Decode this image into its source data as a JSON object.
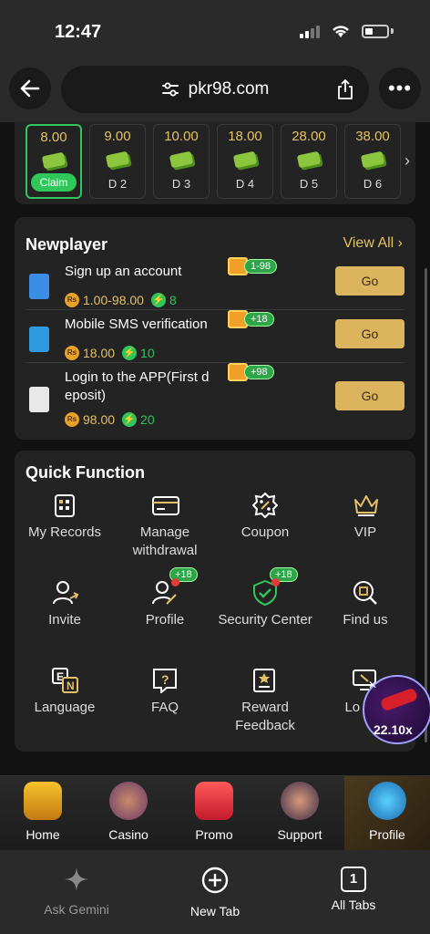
{
  "status": {
    "time": "12:47"
  },
  "browser": {
    "url": "pkr98.com"
  },
  "daily": [
    {
      "amount": "8.00",
      "label": "Claim",
      "active": true
    },
    {
      "amount": "9.00",
      "label": "D 2"
    },
    {
      "amount": "10.00",
      "label": "D 3"
    },
    {
      "amount": "18.00",
      "label": "D 4"
    },
    {
      "amount": "28.00",
      "label": "D 5"
    },
    {
      "amount": "38.00",
      "label": "D 6"
    }
  ],
  "newplayer": {
    "title": "Newplayer",
    "view_all": "View All",
    "tasks": [
      {
        "title": "Sign up an account",
        "badge": "1-98",
        "amount": "1.00-98.00",
        "points": "8",
        "go": "Go"
      },
      {
        "title": "Mobile SMS verification",
        "badge": "+18",
        "amount": "18.00",
        "points": "10",
        "go": "Go"
      },
      {
        "title": "Login to the APP(First d eposit)",
        "badge": "+98",
        "amount": "98.00",
        "points": "20",
        "go": "Go"
      }
    ]
  },
  "quick_function": {
    "title": "Quick Function",
    "items": [
      {
        "label": "My Records",
        "icon": "records-icon"
      },
      {
        "label": "Manage withdrawal",
        "icon": "card-icon"
      },
      {
        "label": "Coupon",
        "icon": "coupon-icon"
      },
      {
        "label": "VIP",
        "icon": "crown-icon"
      },
      {
        "label": "Invite",
        "icon": "invite-icon"
      },
      {
        "label": "Profile",
        "icon": "profile-edit-icon",
        "badge": "+18"
      },
      {
        "label": "Security Center",
        "icon": "shield-icon",
        "badge": "+18"
      },
      {
        "label": "Find us",
        "icon": "find-icon"
      },
      {
        "label": "Language",
        "icon": "language-icon"
      },
      {
        "label": "FAQ",
        "icon": "question-icon"
      },
      {
        "label": "Reward Feedback",
        "icon": "feedback-icon"
      },
      {
        "label": "Lo dev",
        "icon": "device-icon"
      }
    ]
  },
  "bubble": {
    "value": "22.10x"
  },
  "app_tabs": [
    {
      "label": "Home"
    },
    {
      "label": "Casino"
    },
    {
      "label": "Promo"
    },
    {
      "label": "Support"
    },
    {
      "label": "Profile",
      "active": true
    }
  ],
  "browser_bar": {
    "ask": "Ask Gemini",
    "new_tab": "New Tab",
    "all_tabs": "All Tabs",
    "tab_count": "1"
  }
}
